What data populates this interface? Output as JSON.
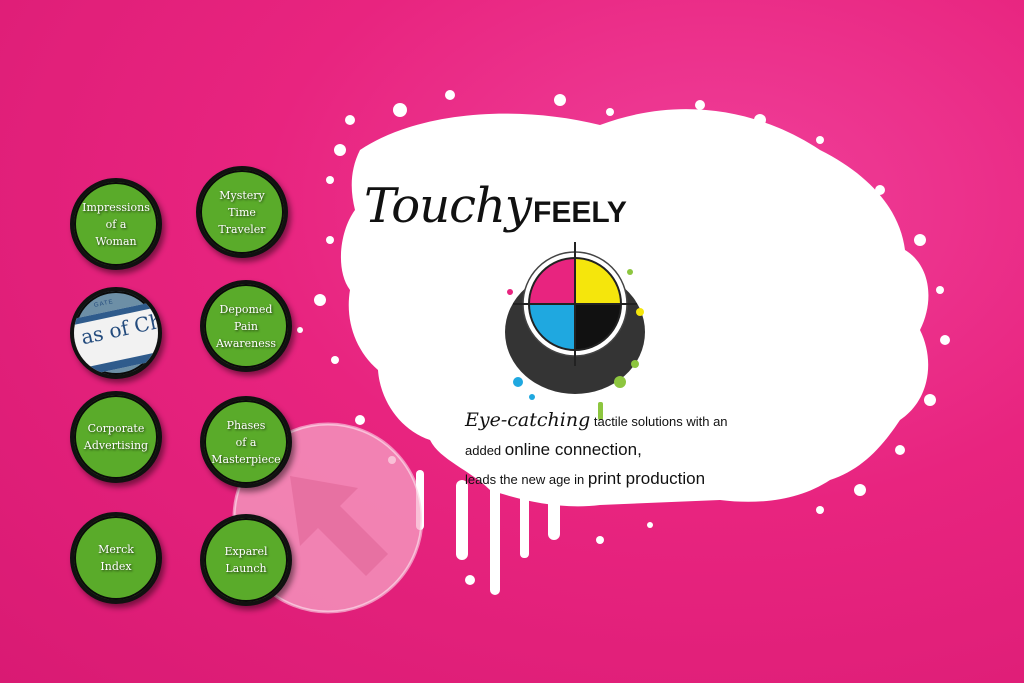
{
  "colors": {
    "background": "#e8247f",
    "splash": "#ffffff",
    "button_fill": "#5aab2a",
    "button_border": "#111111",
    "cyan": "#1fa8e0",
    "magenta": "#e8247f",
    "yellow": "#f5e60c",
    "black": "#111111",
    "lime": "#8dc63f"
  },
  "title": {
    "part1": "Touchy",
    "part2": "FEELY"
  },
  "tagline": {
    "line1_a": "Eye-catching",
    "line1_b": " tactile solutions with an",
    "line2_a": "added ",
    "line2_b": "online connection,",
    "line3_a": "leads the new age in ",
    "line3_b": "print production"
  },
  "nav_buttons": [
    {
      "label": "Impressions\nof a\nWoman"
    },
    {
      "label": "Mystery\nTime\nTraveler"
    },
    {
      "label": "Gate\nAreas of Change",
      "photo_text": "as of Chang",
      "photo_small": "GATE"
    },
    {
      "label": "Depomed\nPain\nAwareness"
    },
    {
      "label": "Corporate\nAdvertising"
    },
    {
      "label": "Phases\nof a\nMasterpiece"
    },
    {
      "label": "Merck\nIndex"
    },
    {
      "label": "Exparel\nLaunch"
    }
  ],
  "icons": {
    "logo": "registration-target-icon",
    "nav": "arrow-cursor-icon"
  }
}
